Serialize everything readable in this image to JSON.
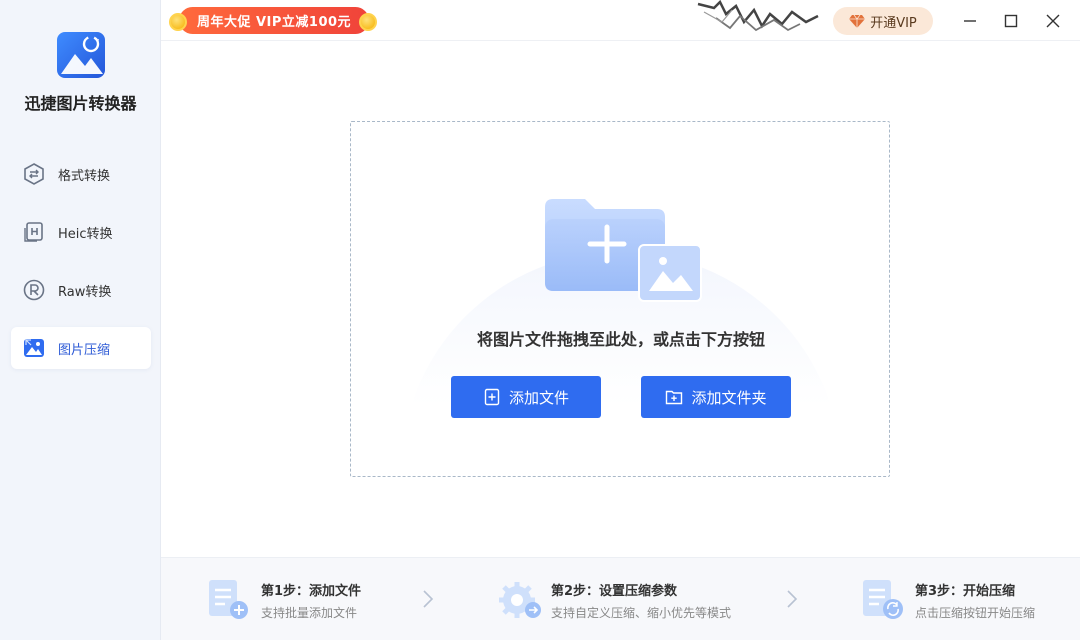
{
  "app": {
    "name": "迅捷图片转换器"
  },
  "sidebar": {
    "items": [
      {
        "label": "格式转换",
        "icon": "format-convert-icon",
        "active": false
      },
      {
        "label": "Heic转换",
        "icon": "heic-icon",
        "active": false
      },
      {
        "label": "Raw转换",
        "icon": "raw-icon",
        "active": false
      },
      {
        "label": "图片压缩",
        "icon": "image-compress-icon",
        "active": true
      }
    ]
  },
  "topbar": {
    "promo_label": "周年大促 VIP立减100元",
    "vip_label": "开通VIP",
    "window_controls": [
      "minimize-icon",
      "maximize-icon",
      "close-icon"
    ]
  },
  "dropzone": {
    "hint": "将图片文件拖拽至此处，或点击下方按钮",
    "add_file_label": "添加文件",
    "add_folder_label": "添加文件夹"
  },
  "steps": [
    {
      "title": "第1步：添加文件",
      "desc": "支持批量添加文件"
    },
    {
      "title": "第2步：设置压缩参数",
      "desc": "支持自定义压缩、缩小优先等模式"
    },
    {
      "title": "第3步：开始压缩",
      "desc": "点击压缩按钮开始压缩"
    }
  ],
  "colors": {
    "accent": "#2f6cf0",
    "active_text": "#2e5bd6",
    "promo": "#f0433a",
    "sidebar_bg": "#f2f5fb"
  }
}
